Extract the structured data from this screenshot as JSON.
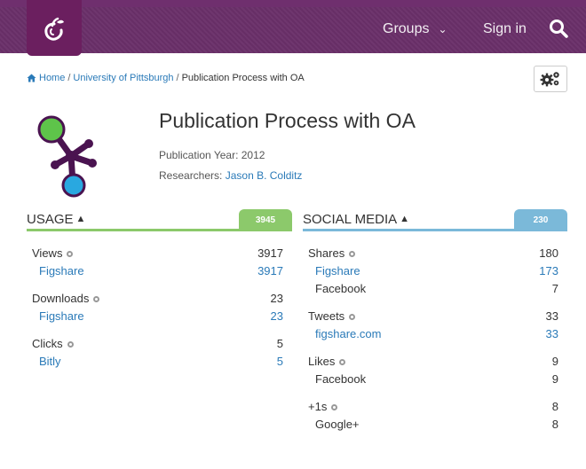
{
  "nav": {
    "groups_label": "Groups",
    "signin_label": "Sign in"
  },
  "breadcrumb": {
    "home": "Home",
    "institution": "University of Pittsburgh",
    "current": "Publication Process with OA",
    "separator": "/"
  },
  "publication": {
    "title": "Publication Process with OA",
    "year_label": "Publication Year: 2012",
    "researchers_label": "Researchers:",
    "researcher": "Jason B. Colditz"
  },
  "usage": {
    "title": "USAGE",
    "total": "3945",
    "accent": "#8cc96b",
    "groups": [
      {
        "label": "Views",
        "value": "3917",
        "sources": [
          {
            "label": "Figshare",
            "value": "3917",
            "link": true
          }
        ]
      },
      {
        "label": "Downloads",
        "value": "23",
        "sources": [
          {
            "label": "Figshare",
            "value": "23",
            "link": true
          }
        ]
      },
      {
        "label": "Clicks",
        "value": "5",
        "sources": [
          {
            "label": "Bitly",
            "value": "5",
            "link": true
          }
        ]
      }
    ]
  },
  "social": {
    "title": "SOCIAL MEDIA",
    "total": "230",
    "accent": "#7bb9d9",
    "groups": [
      {
        "label": "Shares",
        "value": "180",
        "sources": [
          {
            "label": "Figshare",
            "value": "173",
            "link": true
          },
          {
            "label": "Facebook",
            "value": "7",
            "link": false
          }
        ]
      },
      {
        "label": "Tweets",
        "value": "33",
        "sources": [
          {
            "label": "figshare.com",
            "value": "33",
            "link": true
          }
        ]
      },
      {
        "label": "Likes",
        "value": "9",
        "sources": [
          {
            "label": "Facebook",
            "value": "9",
            "link": false
          }
        ]
      },
      {
        "label": "+1s",
        "value": "8",
        "sources": [
          {
            "label": "Google+",
            "value": "8",
            "link": false
          }
        ]
      }
    ]
  },
  "colors": {
    "nav_bg": "#6a2f69",
    "link": "#2a7ab8"
  },
  "icons": {
    "logo": "fruit-logo-icon",
    "search": "search-icon",
    "home": "home-icon",
    "settings": "gears-icon",
    "info": "info-icon"
  }
}
